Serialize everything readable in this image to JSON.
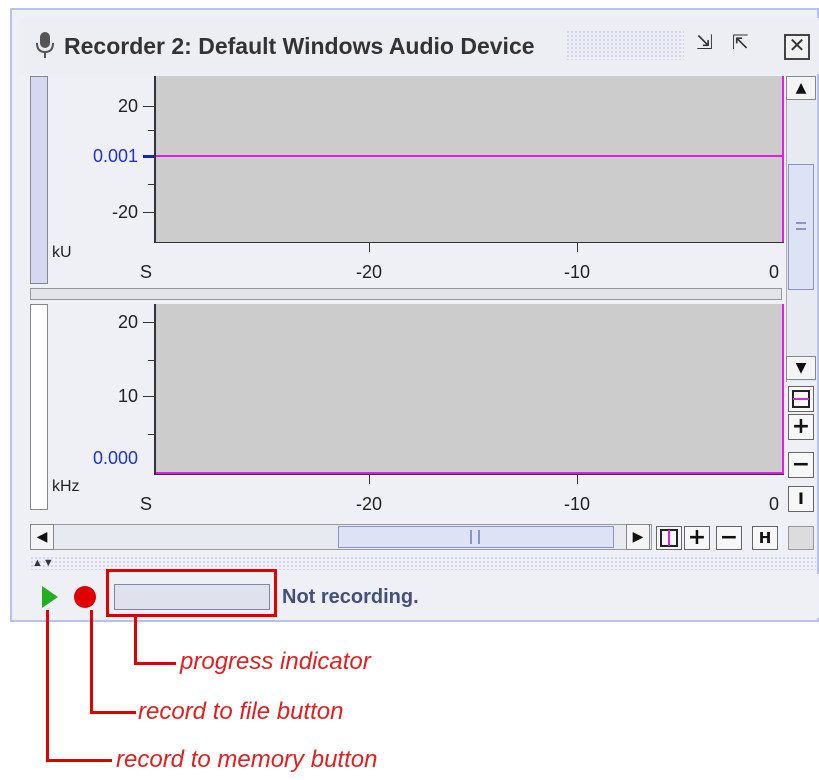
{
  "window": {
    "title": "Recorder 2: Default Windows Audio Device",
    "minimize_glyph": "⇲",
    "maximize_glyph": "⇱",
    "close_glyph": "✕"
  },
  "upper_plot": {
    "y_ticks": [
      "20",
      "-20"
    ],
    "y_value_label": "0.001",
    "unit": "kU",
    "x_ticks": [
      "S",
      "-20",
      "-10",
      "0"
    ]
  },
  "lower_plot": {
    "y_ticks": [
      "20",
      "10"
    ],
    "y_value_label": "0.000",
    "unit": "kHz",
    "x_ticks": [
      "S",
      "-20",
      "-10",
      "0"
    ]
  },
  "side_tools": {
    "zoom_in": "+",
    "zoom_out": "−",
    "fit": "I"
  },
  "bottom_tools": {
    "zoom_in": "+",
    "zoom_out": "−",
    "fit": "H"
  },
  "status": {
    "text": "Not recording.",
    "progress": 0
  },
  "callouts": {
    "progress": "progress indicator",
    "record_file": "record to file button",
    "record_memory": "record to memory button"
  },
  "colors": {
    "plot_bg": "#cccccc",
    "trace": "#e020e0",
    "callout_red": "#e02020",
    "record_red": "#e00000",
    "play_green": "#22b022"
  }
}
